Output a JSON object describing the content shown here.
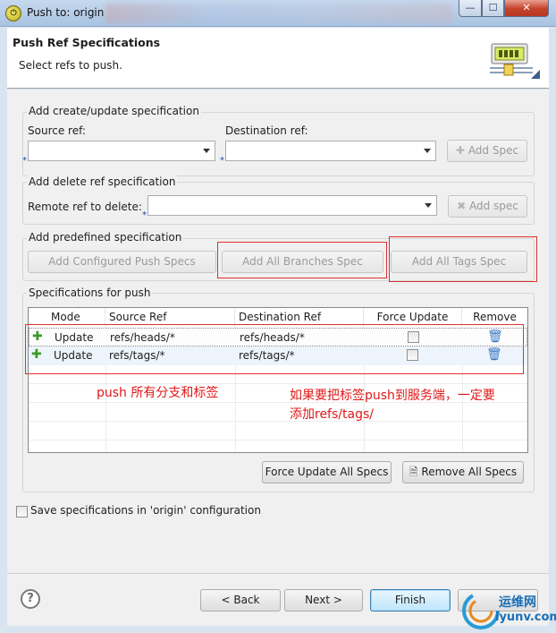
{
  "window": {
    "title": "Push to: origin",
    "icon_glyph": "⏻"
  },
  "header": {
    "title": "Push Ref Specifications",
    "subtitle": "Select refs to push."
  },
  "create_update": {
    "group_label": "Add create/update specification",
    "source_label": "Source ref:",
    "dest_label": "Destination ref:",
    "source_value": "",
    "dest_value": "",
    "add_button": "Add Spec",
    "required_marker": "*"
  },
  "delete_ref": {
    "group_label": "Add delete ref specification",
    "remote_label": "Remote ref to delete:",
    "remote_value": "",
    "add_button": "Add spec"
  },
  "predefined": {
    "group_label": "Add predefined specification",
    "configured_button": "Add Configured Push Specs",
    "branches_button": "Add All Branches Spec",
    "tags_button": "Add All Tags Spec"
  },
  "specs": {
    "group_label": "Specifications for push",
    "columns": [
      "Mode",
      "Source Ref",
      "Destination Ref",
      "Force Update",
      "Remove"
    ],
    "rows": [
      {
        "mode": "Update",
        "source": "refs/heads/*",
        "dest": "refs/heads/*",
        "force": false
      },
      {
        "mode": "Update",
        "source": "refs/tags/*",
        "dest": "refs/tags/*",
        "force": false
      }
    ],
    "force_all_button": "Force Update All Specs",
    "remove_all_button": "Remove All Specs"
  },
  "annotations": {
    "note_left": "push 所有分支和标签",
    "note_right_line1": "如果要把标签push到服务端，一定要",
    "note_right_line2": "添加refs/tags/"
  },
  "save_config": {
    "label": "Save specifications in 'origin' configuration",
    "checked": false
  },
  "footer": {
    "back_button": "< Back",
    "next_button": "Next >",
    "finish_button": "Finish",
    "help_glyph": "?"
  },
  "watermark": {
    "text_line1": "运维网",
    "text_line2": "iyunv.com"
  },
  "colors": {
    "annotation_red": "#e01818",
    "accent_blue": "#3c7fb1"
  }
}
